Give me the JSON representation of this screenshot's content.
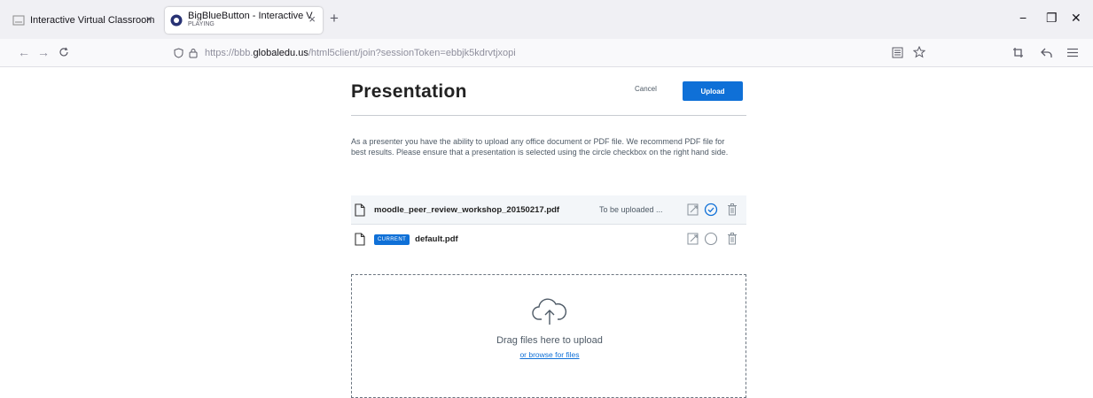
{
  "browser": {
    "tabs": [
      {
        "title": "Interactive Virtual Classroom",
        "close": "×"
      },
      {
        "title": "BigBlueButton - Interactive V",
        "subtitle": "PLAYING",
        "close": "×"
      }
    ],
    "new_tab": "+",
    "window_controls": {
      "minimize": "−",
      "restore": "❐",
      "close": "✕"
    },
    "nav": {
      "back": "←",
      "forward": "→",
      "reload": "C"
    },
    "url_prefix": "https://bbb.",
    "url_domain": "globaledu.us",
    "url_path": "/html5client/join?sessionToken=ebbjk5kdrvtjxopi"
  },
  "modal": {
    "title": "Presentation",
    "cancel_label": "Cancel",
    "upload_label": "Upload",
    "intro": "As a presenter you have the ability to upload any office document or PDF file. We recommend PDF file for best results. Please ensure that a presentation is selected using the circle checkbox on the right hand side.",
    "files": [
      {
        "name": "moodle_peer_review_workshop_20150217.pdf",
        "status": "To be uploaded ...",
        "selected": true
      },
      {
        "name": "default.pdf",
        "badge": "CURRENT",
        "selected": false
      }
    ],
    "dropzone": {
      "text": "Drag files here to upload",
      "browse": "or browse for files"
    }
  },
  "colors": {
    "accent": "#0f70d7",
    "text_muted": "#4e5a66",
    "row_highlight": "#f3f6f9"
  }
}
